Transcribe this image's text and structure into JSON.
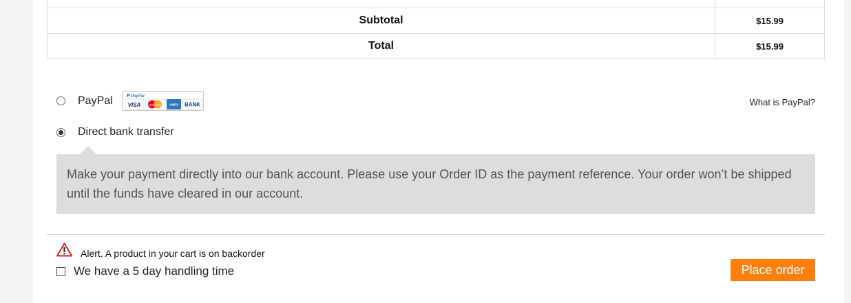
{
  "colors": {
    "accent": "#ff7f0a",
    "panel": "#dedcdd",
    "alert_red": "#d9221c"
  },
  "order_totals": {
    "rows": [
      {
        "label": "Subtotal",
        "amount": "$15.99"
      },
      {
        "label": "Total",
        "amount": "$15.99"
      }
    ]
  },
  "payment": {
    "paypal": {
      "label": "PayPal",
      "selected": false,
      "logo_text": "PayPal",
      "cards": [
        "VISA",
        "MasterCard",
        "AMEX",
        "BANK"
      ],
      "info_link": "What is PayPal?"
    },
    "bank_transfer": {
      "label": "Direct bank transfer",
      "selected": true,
      "description": "Make your payment directly into our bank account. Please use your Order ID as the payment reference. Your order won’t be shipped until the funds have cleared in our account."
    }
  },
  "backorder": {
    "alert_icon": "warning-triangle-icon",
    "alert_text": "Alert. A product in your cart is on backorder",
    "checkbox_label": "We have a 5 day handling time",
    "checked": false
  },
  "actions": {
    "place_order_label": "Place order"
  }
}
